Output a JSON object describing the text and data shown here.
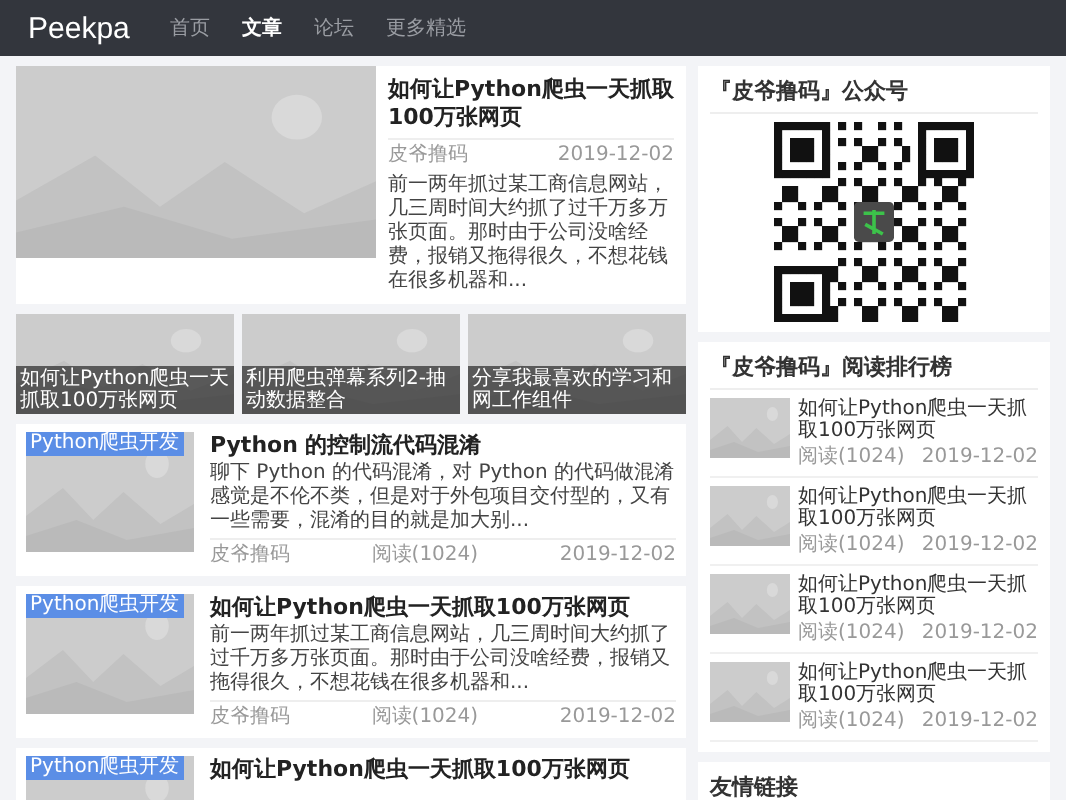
{
  "nav": {
    "brand": "Peekpa",
    "items": [
      {
        "label": "首页",
        "selected": false
      },
      {
        "label": "文章",
        "selected": true
      },
      {
        "label": "论坛",
        "selected": false
      },
      {
        "label": "更多精选",
        "selected": false
      }
    ]
  },
  "featured": {
    "title": "如何让Python爬虫一天抓取100万张网页",
    "author": "皮爷撸码",
    "date": "2019-12-02",
    "excerpt": "前一两年抓过某工商信息网站，几三周时间大约抓了过千万多万张页面。那时由于公司没啥经费，报销又拖得很久，不想花钱在很多机器和..."
  },
  "tiles": [
    {
      "caption": "如何让Python爬虫一天抓取100万张网页"
    },
    {
      "caption": "利用爬虫弹幕系列2-抽动数据整合"
    },
    {
      "caption": "分享我最喜欢的学习和网工作组件"
    }
  ],
  "articles": [
    {
      "tag": "Python爬虫开发",
      "title": "Python 的控制流代码混淆",
      "excerpt": "聊下 Python 的代码混淆，对 Python 的代码做混淆感觉是不伦不类，但是对于外包项目交付型的，又有一些需要，混淆的目的就是加大别...",
      "author": "皮爷撸码",
      "reads": "阅读(1024)",
      "date": "2019-12-02"
    },
    {
      "tag": "Python爬虫开发",
      "title": "如何让Python爬虫一天抓取100万张网页",
      "excerpt": "前一两年抓过某工商信息网站，几三周时间大约抓了过千万多万张页面。那时由于公司没啥经费，报销又拖得很久，不想花钱在很多机器和...",
      "author": "皮爷撸码",
      "reads": "阅读(1024)",
      "date": "2019-12-02"
    },
    {
      "tag": "Python爬虫开发",
      "title": "如何让Python爬虫一天抓取100万张网页"
    }
  ],
  "sidebar": {
    "qr_card": {
      "title": "『皮爷撸码』公众号"
    },
    "ranking": {
      "title": "『皮爷撸码』阅读排行榜",
      "items": [
        {
          "title": "如何让Python爬虫一天抓取100万张网页",
          "reads": "阅读(1024)",
          "date": "2019-12-02"
        },
        {
          "title": "如何让Python爬虫一天抓取100万张网页",
          "reads": "阅读(1024)",
          "date": "2019-12-02"
        },
        {
          "title": "如何让Python爬虫一天抓取100万张网页",
          "reads": "阅读(1024)",
          "date": "2019-12-02"
        },
        {
          "title": "如何让Python爬虫一天抓取100万张网页",
          "reads": "阅读(1024)",
          "date": "2019-12-02"
        }
      ]
    },
    "links": {
      "title": "友情链接"
    }
  }
}
